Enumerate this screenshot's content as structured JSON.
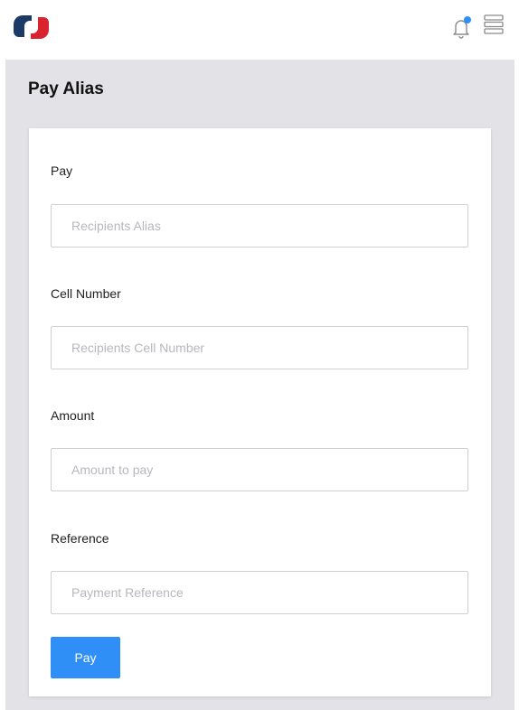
{
  "header": {
    "logo_icon": "bank-logo-icon",
    "notification_icon": "bell-icon",
    "notification_dot_color": "#2f8ff7",
    "menu_icon": "hamburger-menu-icon",
    "brand_colors": [
      "#1b3a66",
      "#d9232f"
    ]
  },
  "page": {
    "title": "Pay Alias"
  },
  "form": {
    "fields": [
      {
        "label": "Pay",
        "placeholder": "Recipients Alias",
        "value": ""
      },
      {
        "label": "Cell Number",
        "placeholder": "Recipients Cell Number",
        "value": ""
      },
      {
        "label": "Amount",
        "placeholder": "Amount to pay",
        "value": ""
      },
      {
        "label": "Reference",
        "placeholder": "Payment Reference",
        "value": ""
      }
    ],
    "submit_label": "Pay",
    "submit_color": "#2f8ff7"
  }
}
